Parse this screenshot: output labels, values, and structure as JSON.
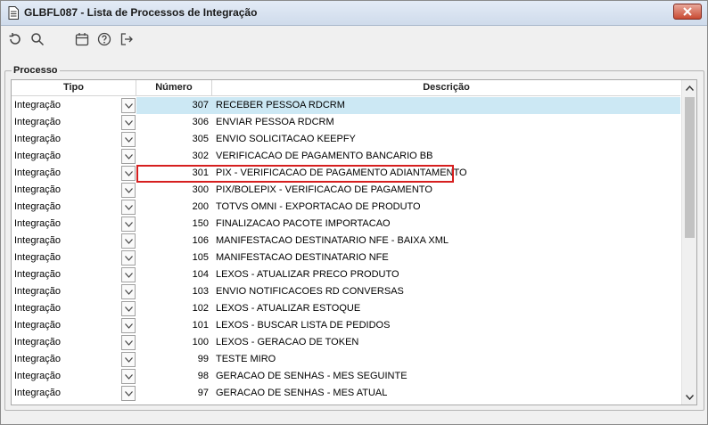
{
  "window": {
    "title": "GLBFL087 - Lista de Processos de Integração",
    "close_icon": "close-icon"
  },
  "toolbar": {
    "buttons": [
      {
        "name": "refresh-icon"
      },
      {
        "name": "search-icon"
      },
      {
        "name": "calendar-icon"
      },
      {
        "name": "help-icon"
      },
      {
        "name": "exit-icon"
      }
    ]
  },
  "group": {
    "label": "Processo"
  },
  "grid": {
    "columns": {
      "tipo": "Tipo",
      "numero": "Número",
      "descricao": "Descrição"
    },
    "selected_row": 0,
    "highlighted_row": 4,
    "rows": [
      {
        "tipo": "Integração",
        "numero": "307",
        "descricao": "RECEBER PESSOA RDCRM"
      },
      {
        "tipo": "Integração",
        "numero": "306",
        "descricao": "ENVIAR PESSOA RDCRM"
      },
      {
        "tipo": "Integração",
        "numero": "305",
        "descricao": "ENVIO SOLICITACAO KEEPFY"
      },
      {
        "tipo": "Integração",
        "numero": "302",
        "descricao": "VERIFICACAO DE PAGAMENTO BANCARIO BB"
      },
      {
        "tipo": "Integração",
        "numero": "301",
        "descricao": "PIX - VERIFICACAO DE PAGAMENTO ADIANTAMENTO"
      },
      {
        "tipo": "Integração",
        "numero": "300",
        "descricao": "PIX/BOLEPIX - VERIFICACAO DE PAGAMENTO"
      },
      {
        "tipo": "Integração",
        "numero": "200",
        "descricao": "TOTVS OMNI - EXPORTACAO DE PRODUTO"
      },
      {
        "tipo": "Integração",
        "numero": "150",
        "descricao": "FINALIZACAO PACOTE IMPORTACAO"
      },
      {
        "tipo": "Integração",
        "numero": "106",
        "descricao": "MANIFESTACAO DESTINATARIO NFE - BAIXA XML"
      },
      {
        "tipo": "Integração",
        "numero": "105",
        "descricao": "MANIFESTACAO DESTINATARIO NFE"
      },
      {
        "tipo": "Integração",
        "numero": "104",
        "descricao": "LEXOS - ATUALIZAR PRECO PRODUTO"
      },
      {
        "tipo": "Integração",
        "numero": "103",
        "descricao": "ENVIO NOTIFICACOES RD CONVERSAS"
      },
      {
        "tipo": "Integração",
        "numero": "102",
        "descricao": "LEXOS - ATUALIZAR ESTOQUE"
      },
      {
        "tipo": "Integração",
        "numero": "101",
        "descricao": "LEXOS - BUSCAR LISTA DE PEDIDOS"
      },
      {
        "tipo": "Integração",
        "numero": "100",
        "descricao": "LEXOS - GERACAO DE TOKEN"
      },
      {
        "tipo": "Integração",
        "numero": "99",
        "descricao": "TESTE MIRO"
      },
      {
        "tipo": "Integração",
        "numero": "98",
        "descricao": "GERACAO DE SENHAS - MES SEGUINTE"
      },
      {
        "tipo": "Integração",
        "numero": "97",
        "descricao": "GERACAO DE SENHAS - MES ATUAL"
      }
    ]
  },
  "colors": {
    "selection": "#cce8f4",
    "highlight_outline": "#d61f1f",
    "close_button": "#c94a32"
  }
}
